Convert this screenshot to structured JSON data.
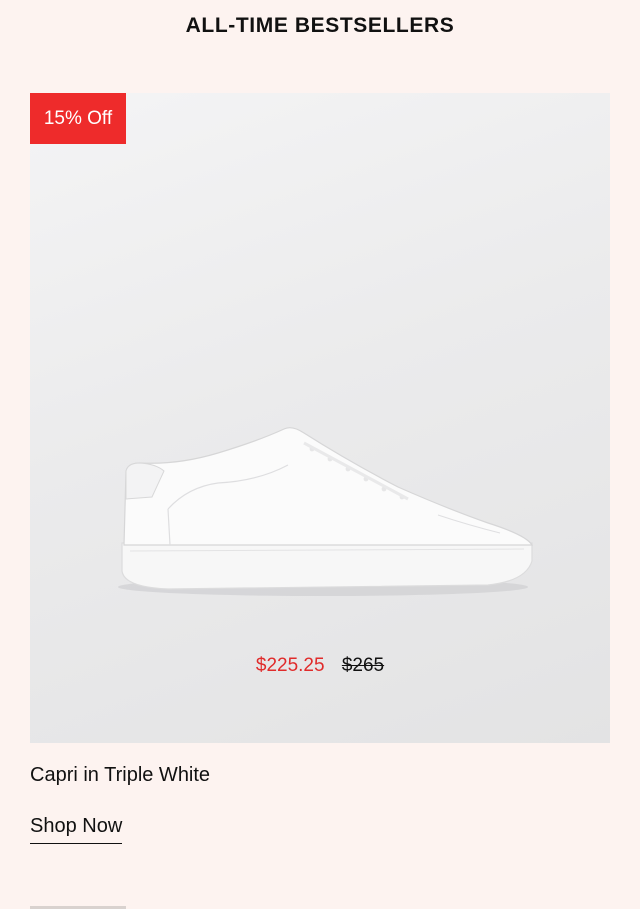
{
  "section": {
    "title": "ALL-TIME BESTSELLERS"
  },
  "product": {
    "badge": "15% Off",
    "image_icon": "sneaker-image",
    "sale_price": "$225.25",
    "original_price": "$265",
    "name": "Capri in Triple White",
    "cta_label": "Shop Now"
  },
  "colors": {
    "page_background": "#fdf3f0",
    "badge_red": "#ee2b2b",
    "sale_price_red": "#e02b2b",
    "text": "#111111"
  }
}
